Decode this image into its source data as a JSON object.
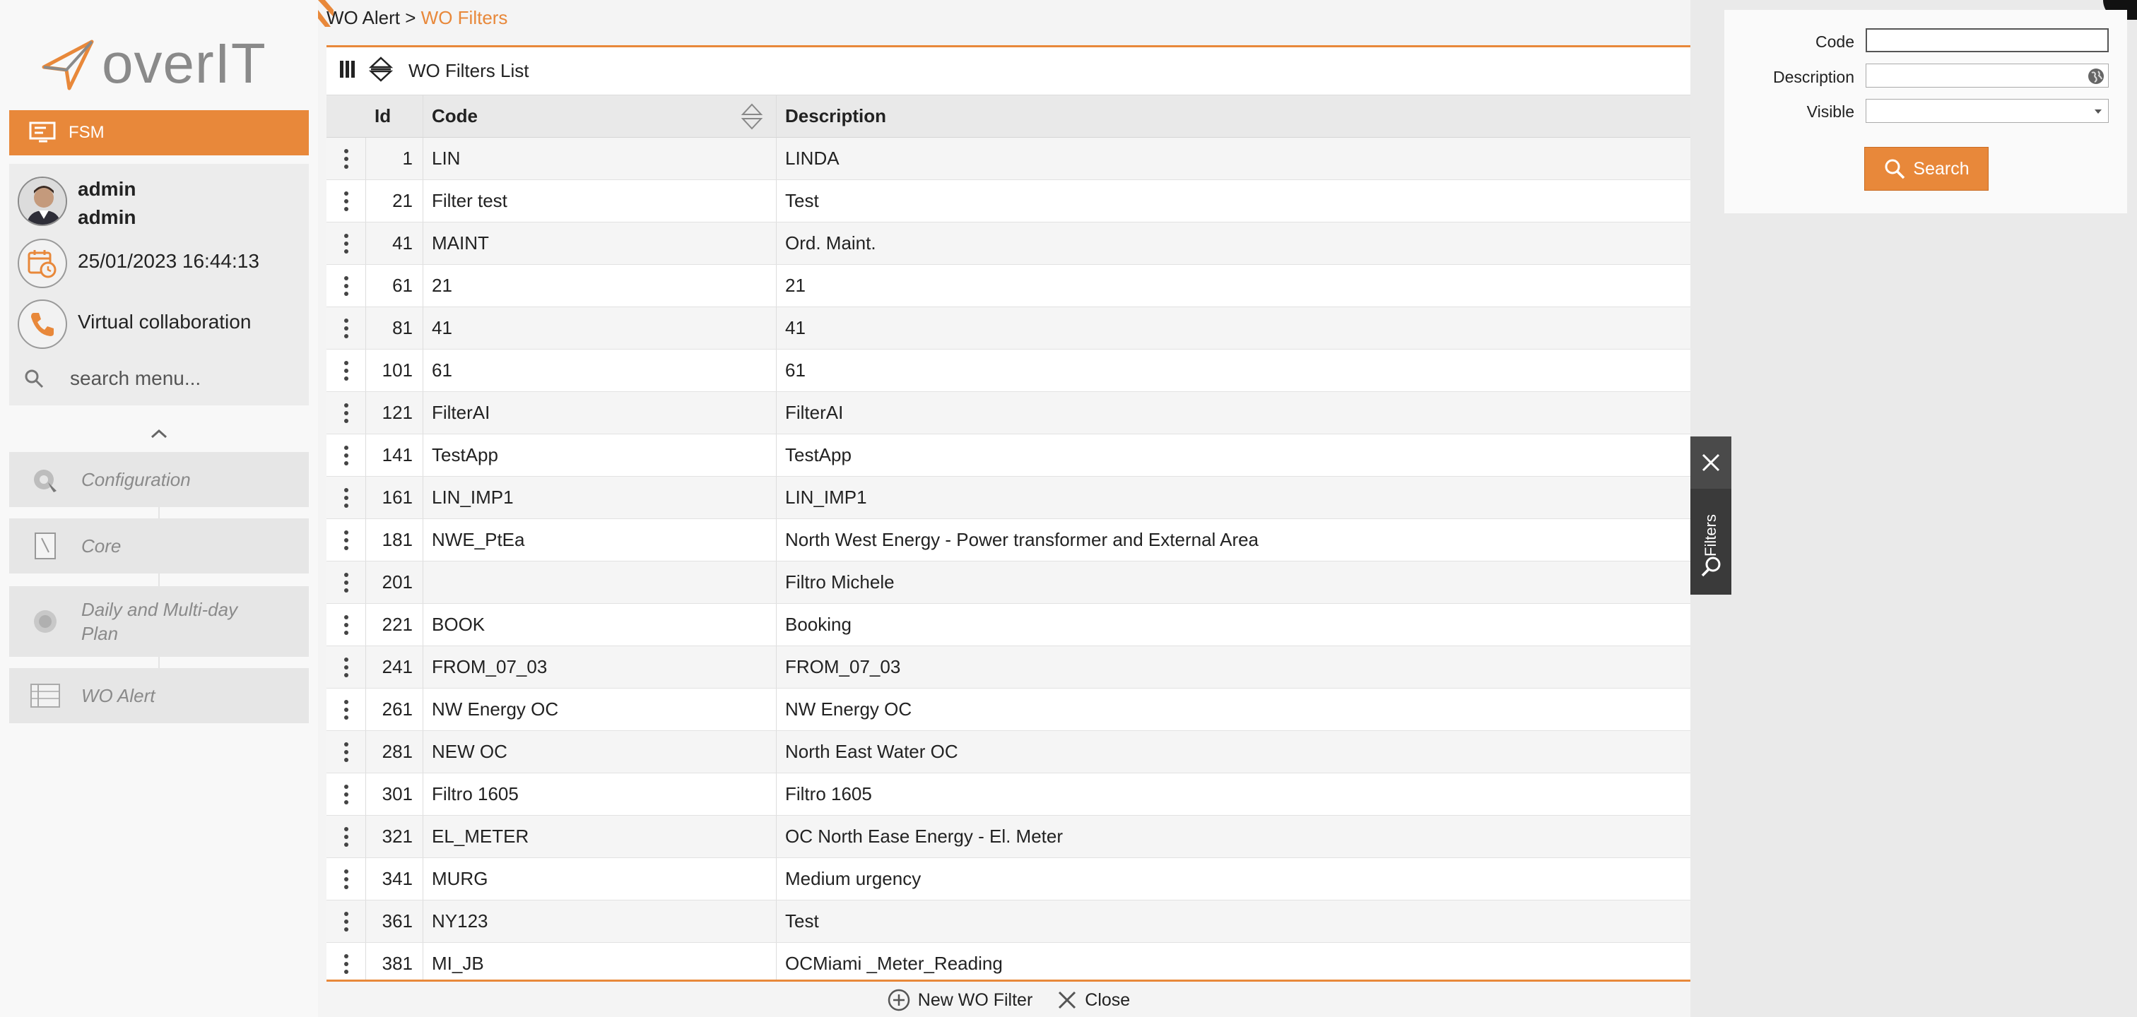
{
  "logo": {
    "text": "overIT"
  },
  "app": {
    "module_label": "FSM"
  },
  "user": {
    "first": "admin",
    "second": "admin",
    "datetime": "25/01/2023 16:44:13",
    "collab": "Virtual collaboration"
  },
  "menu_search": {
    "placeholder": "search menu..."
  },
  "menu": [
    {
      "label": "Configuration",
      "icon": "configuration-icon"
    },
    {
      "label": "Core",
      "icon": "core-icon"
    },
    {
      "label": "Daily and Multi-day Plan",
      "icon": "plan-icon"
    },
    {
      "label": "WO Alert",
      "icon": "wo-alert-icon"
    }
  ],
  "breadcrumb": {
    "parent": "WO Alert",
    "separator": ">",
    "current": "WO Filters"
  },
  "grid": {
    "title": "WO Filters List",
    "columns": {
      "id": "Id",
      "code": "Code",
      "description": "Description"
    },
    "rows": [
      {
        "id": "1",
        "code": "LIN",
        "description": "LINDA"
      },
      {
        "id": "21",
        "code": "Filter test",
        "description": "Test"
      },
      {
        "id": "41",
        "code": "MAINT",
        "description": "Ord. Maint."
      },
      {
        "id": "61",
        "code": "21",
        "description": "21"
      },
      {
        "id": "81",
        "code": "41",
        "description": "41"
      },
      {
        "id": "101",
        "code": "61",
        "description": "61"
      },
      {
        "id": "121",
        "code": "FilterAI",
        "description": "FilterAI"
      },
      {
        "id": "141",
        "code": "TestApp",
        "description": "TestApp"
      },
      {
        "id": "161",
        "code": "LIN_IMP1",
        "description": "LIN_IMP1"
      },
      {
        "id": "181",
        "code": "NWE_PtEa",
        "description": "North West Energy - Power transformer and External Area"
      },
      {
        "id": "201",
        "code": "",
        "description": "Filtro Michele"
      },
      {
        "id": "221",
        "code": "BOOK",
        "description": "Booking"
      },
      {
        "id": "241",
        "code": "FROM_07_03",
        "description": "FROM_07_03"
      },
      {
        "id": "261",
        "code": "NW Energy OC",
        "description": "NW Energy OC"
      },
      {
        "id": "281",
        "code": "NEW OC",
        "description": "North East Water OC"
      },
      {
        "id": "301",
        "code": "Filtro 1605",
        "description": "Filtro 1605"
      },
      {
        "id": "321",
        "code": "EL_METER",
        "description": "OC North Ease Energy - El. Meter"
      },
      {
        "id": "341",
        "code": "MURG",
        "description": "Medium urgency"
      },
      {
        "id": "361",
        "code": "NY123",
        "description": "Test"
      },
      {
        "id": "381",
        "code": "MI_JB",
        "description": "OCMiami _Meter_Reading"
      }
    ]
  },
  "footer": {
    "new_label": "New WO Filter",
    "close_label": "Close"
  },
  "filters": {
    "code_label": "Code",
    "code_value": "",
    "description_label": "Description",
    "description_value": "",
    "visible_label": "Visible",
    "visible_value": "",
    "search_label": "Search",
    "tab_label": "Filters"
  },
  "colors": {
    "accent": "#e8883a",
    "dark_tab": "#3a3a3a"
  }
}
